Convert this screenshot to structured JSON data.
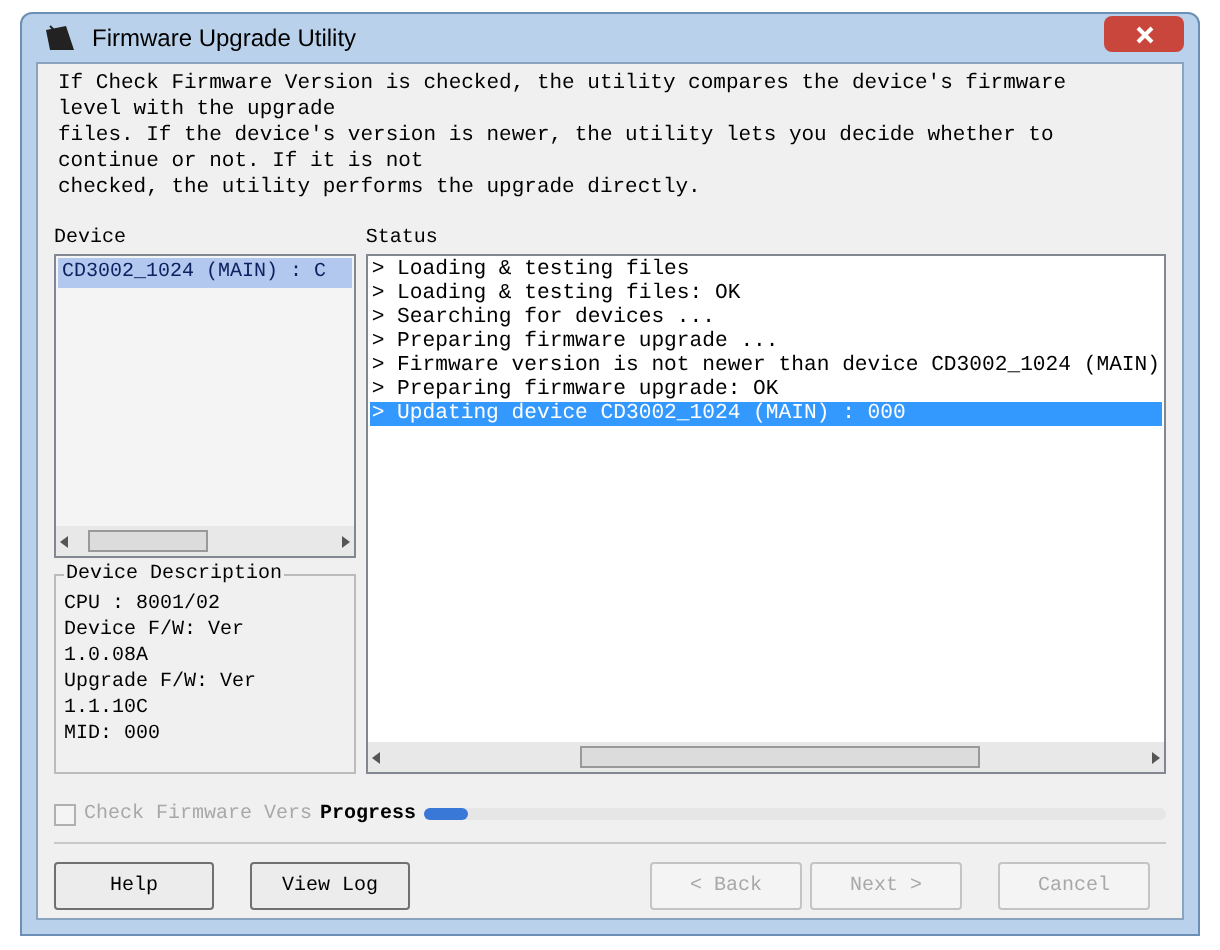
{
  "window": {
    "title": "Firmware Upgrade Utility"
  },
  "intro": [
    "If Check Firmware Version is checked, the utility compares the device's firmware level with the upgrade",
    "files. If the device's version is newer, the utility lets you decide whether to continue or not. If it is not",
    "checked, the utility performs the upgrade directly."
  ],
  "device_panel": {
    "label": "Device",
    "items": [
      {
        "text": "CD3002_1024 (MAIN) : C",
        "selected": true
      }
    ]
  },
  "device_description": {
    "title": "Device Description",
    "lines": [
      "CPU : 8001/02",
      "Device F/W: Ver",
      "1.0.08A",
      "Upgrade F/W: Ver",
      "1.1.10C",
      "MID: 000"
    ]
  },
  "status_panel": {
    "label": "Status",
    "items": [
      {
        "text": "> Loading & testing files",
        "selected": false
      },
      {
        "text": "> Loading & testing files: OK",
        "selected": false
      },
      {
        "text": "> Searching for devices ...",
        "selected": false
      },
      {
        "text": "> Preparing firmware upgrade ...",
        "selected": false
      },
      {
        "text": "> Firmware version is not newer than device CD3002_1024 (MAIN)",
        "selected": false
      },
      {
        "text": "> Preparing firmware upgrade: OK",
        "selected": false
      },
      {
        "text": "> Updating device CD3002_1024 (MAIN) : 000",
        "selected": true
      }
    ]
  },
  "check_firmware": {
    "label": "Check Firmware Vers",
    "checked": false,
    "disabled": true
  },
  "progress": {
    "label": "Progress",
    "level": 0.06
  },
  "buttons": [
    {
      "label": "Help",
      "disabled": false
    },
    {
      "label": "View Log",
      "disabled": false
    },
    {
      "label": "< Back",
      "disabled": true
    },
    {
      "label": "Next >",
      "disabled": true
    },
    {
      "label": "Cancel",
      "disabled": true
    }
  ]
}
